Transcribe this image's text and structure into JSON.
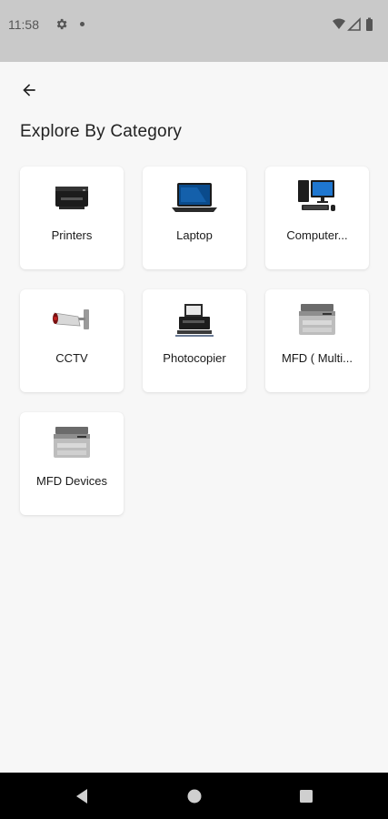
{
  "status_bar": {
    "time": "11:58"
  },
  "header": {
    "title": "Explore By Category"
  },
  "categories": [
    {
      "label": "Printers",
      "icon": "printer-icon"
    },
    {
      "label": "Laptop",
      "icon": "laptop-icon"
    },
    {
      "label": "Computer...",
      "icon": "desktop-computer-icon"
    },
    {
      "label": "CCTV",
      "icon": "cctv-camera-icon"
    },
    {
      "label": "Photocopier",
      "icon": "photocopier-icon"
    },
    {
      "label": "MFD ( Multi...",
      "icon": "mfd-printer-icon"
    },
    {
      "label": "MFD Devices",
      "icon": "mfd-printer-icon"
    }
  ],
  "colors": {
    "status_bar": "#c9c9c9",
    "background": "#f7f7f7",
    "nav_bar": "#000000",
    "card": "#ffffff"
  }
}
